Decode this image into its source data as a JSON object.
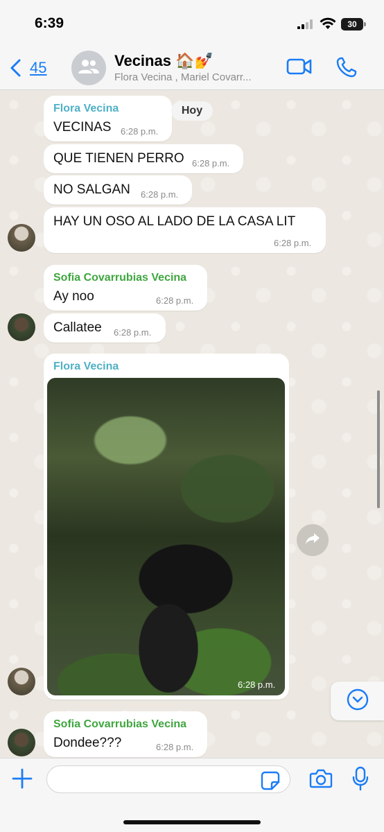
{
  "status_bar": {
    "time": "6:39",
    "battery": "30"
  },
  "header": {
    "back_count": "45",
    "title": "Vecinas 🏠💅",
    "subtitle": "Flora Vecina , Mariel Covarr...",
    "accent_color": "#1a7cf5"
  },
  "chat": {
    "date_label": "Hoy",
    "messages": [
      {
        "sender": "Flora Vecina",
        "sender_color": "#4fb0c6",
        "text": "VECINAS",
        "time": "6:28 p.m."
      },
      {
        "text": "QUE TIENEN PERRO",
        "time": "6:28 p.m."
      },
      {
        "text": "NO SALGAN",
        "time": "6:28 p.m."
      },
      {
        "text": "HAY UN OSO AL LADO DE LA CASA LIT",
        "time": "6:28 p.m."
      },
      {
        "sender": "Sofia Covarrubias Vecina",
        "sender_color": "#3fa63f",
        "text": "Ay noo",
        "time": "6:28 p.m."
      },
      {
        "text": "Callatee",
        "time": "6:28 p.m."
      },
      {
        "sender": "Flora Vecina",
        "sender_color": "#4fb0c6",
        "type": "photo",
        "time": "6:28 p.m."
      },
      {
        "sender": "Sofia Covarrubias Vecina",
        "sender_color": "#3fa63f",
        "text": "Dondee???",
        "time": "6:28 p.m."
      }
    ]
  },
  "icons": {
    "back": "chevron-left-icon",
    "group_avatar": "group-icon",
    "video": "video-camera-icon",
    "call": "phone-icon",
    "forward": "forward-arrow-icon",
    "scroll_down": "chevron-down-icon",
    "attach": "plus-icon",
    "sticker": "sticker-icon",
    "camera": "camera-icon",
    "mic": "microphone-icon"
  }
}
